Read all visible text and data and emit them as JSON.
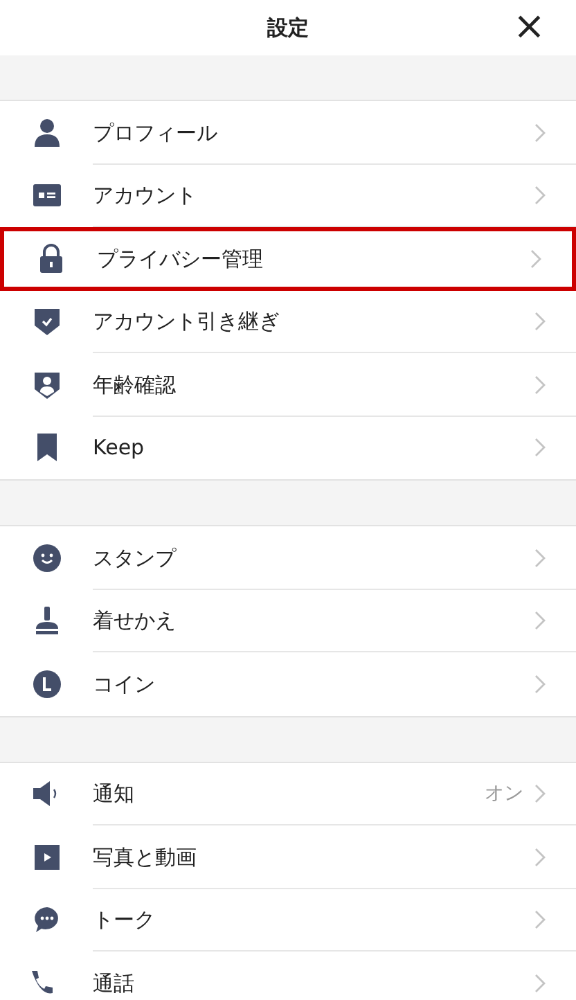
{
  "header": {
    "title": "設定",
    "close": "×"
  },
  "sections": [
    {
      "items": [
        {
          "kind": "person",
          "label": "プロフィール",
          "highlighted": false
        },
        {
          "kind": "card",
          "label": "アカウント",
          "highlighted": false
        },
        {
          "kind": "lock",
          "label": "プライバシー管理",
          "highlighted": true
        },
        {
          "kind": "shield-check",
          "label": "アカウント引き継ぎ",
          "highlighted": false
        },
        {
          "kind": "shield-person",
          "label": "年齢確認",
          "highlighted": false
        },
        {
          "kind": "bookmark",
          "label": "Keep",
          "highlighted": false
        }
      ]
    },
    {
      "items": [
        {
          "kind": "smiley",
          "label": "スタンプ",
          "highlighted": false
        },
        {
          "kind": "brush",
          "label": "着せかえ",
          "highlighted": false
        },
        {
          "kind": "coin",
          "label": "コイン",
          "highlighted": false
        }
      ]
    },
    {
      "items": [
        {
          "kind": "speaker",
          "label": "通知",
          "value": "オン",
          "highlighted": false
        },
        {
          "kind": "play",
          "label": "写真と動画",
          "highlighted": false
        },
        {
          "kind": "chat",
          "label": "トーク",
          "highlighted": false
        },
        {
          "kind": "phone",
          "label": "通話",
          "highlighted": false
        }
      ]
    }
  ]
}
